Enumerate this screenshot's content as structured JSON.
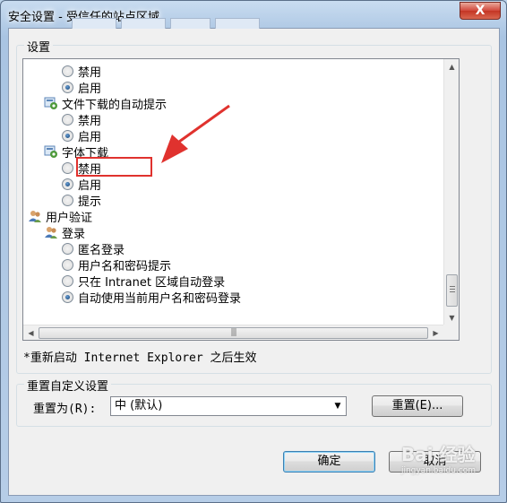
{
  "window": {
    "title": "安全设置 - 受信任的站点区域",
    "close_label": "X"
  },
  "settings_group": {
    "label": "设置"
  },
  "tree": [
    {
      "type": "radio",
      "label": "禁用",
      "checked": false,
      "indent": 2
    },
    {
      "type": "radio",
      "label": "启用",
      "checked": true,
      "indent": 2
    },
    {
      "type": "category",
      "label": "文件下载的自动提示",
      "icon": "settings-node-icon",
      "indent": 1
    },
    {
      "type": "radio",
      "label": "禁用",
      "checked": false,
      "indent": 2
    },
    {
      "type": "radio",
      "label": "启用",
      "checked": true,
      "indent": 2
    },
    {
      "type": "category",
      "label": "字体下载",
      "icon": "settings-node-icon",
      "indent": 1
    },
    {
      "type": "radio",
      "label": "禁用",
      "checked": false,
      "indent": 2
    },
    {
      "type": "radio",
      "label": "启用",
      "checked": true,
      "indent": 2
    },
    {
      "type": "radio",
      "label": "提示",
      "checked": false,
      "indent": 2
    },
    {
      "type": "category",
      "label": "用户验证",
      "icon": "users-icon",
      "indent": 0
    },
    {
      "type": "category",
      "label": "登录",
      "icon": "users-icon",
      "indent": 1
    },
    {
      "type": "radio",
      "label": "匿名登录",
      "checked": false,
      "indent": 2
    },
    {
      "type": "radio",
      "label": "用户名和密码提示",
      "checked": false,
      "indent": 2
    },
    {
      "type": "radio",
      "label": "只在 Intranet 区域自动登录",
      "checked": false,
      "indent": 2
    },
    {
      "type": "radio",
      "label": "自动使用当前用户名和密码登录",
      "checked": true,
      "indent": 2
    }
  ],
  "note": "*重新启动 Internet Explorer 之后生效",
  "reset_group": {
    "label": "重置自定义设置",
    "reset_to_label": "重置为(R):",
    "select_value": "中 (默认)",
    "reset_button": "重置(E)..."
  },
  "buttons": {
    "ok": "确定",
    "cancel": "取消"
  },
  "watermark": {
    "text": "Bai 经验",
    "subtext": "jingyan.baidu.com"
  },
  "colors": {
    "annotation": "#e0322e"
  }
}
